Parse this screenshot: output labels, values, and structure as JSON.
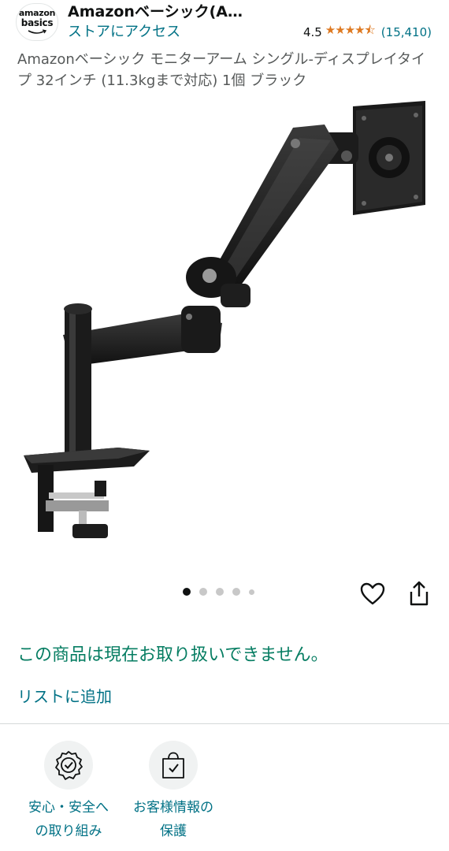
{
  "store": {
    "logo_line1": "amazon",
    "logo_line2": "basics",
    "name": "Amazonベーシック(A…",
    "visit_link": "ストアにアクセス",
    "rating_value": "4.5",
    "rating_stars": "★★★★⯪",
    "rating_count": "(15,410)"
  },
  "product": {
    "title": "Amazonベーシック モニターアーム シングル-ディスプレイタイプ 32インチ (11.3kgまで対応) 1個 ブラック",
    "image_icon": "monitor-arm-image",
    "carousel_total": 5,
    "carousel_active": 1
  },
  "actions": {
    "favorite_icon": "heart-icon",
    "share_icon": "share-icon"
  },
  "availability": {
    "message": "この商品は現在お取り扱いできません。",
    "add_to_list": "リストに追加"
  },
  "trust": [
    {
      "icon": "shield-check-icon",
      "label_line1": "安心・安全へ",
      "label_line2": "の取り組み"
    },
    {
      "icon": "secure-bag-icon",
      "label_line1": "お客様情報の",
      "label_line2": "保護"
    }
  ],
  "colors": {
    "link": "#007185",
    "success": "#067d62",
    "star": "#de7921"
  }
}
